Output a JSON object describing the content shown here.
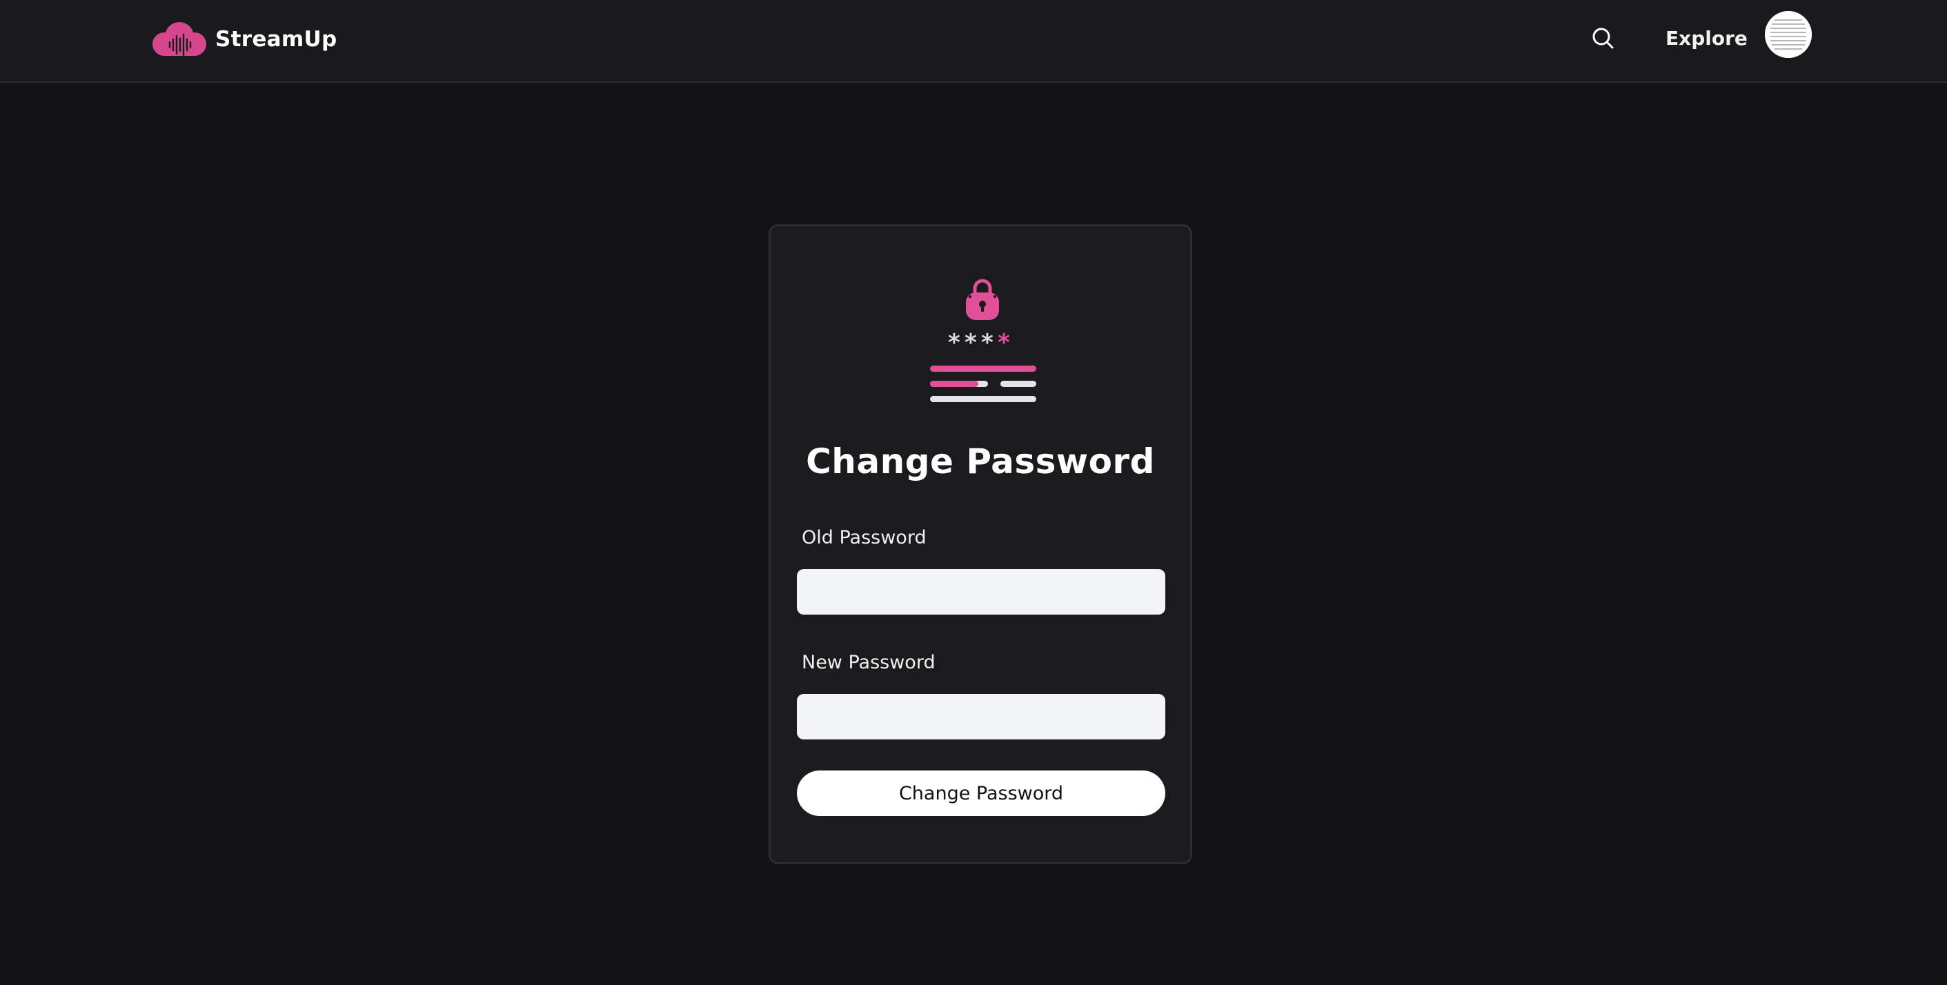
{
  "brand": {
    "name": "StreamUp",
    "logo_icon": "cloud-soundwave-icon",
    "accent_color": "#d6468c"
  },
  "nav": {
    "search_icon": "search-icon",
    "explore_label": "Explore",
    "avatar_icon": "user-avatar"
  },
  "card": {
    "illustration_icon": "lock-password-icon",
    "title": "Change Password",
    "old_password": {
      "label": "Old Password",
      "value": "",
      "placeholder": ""
    },
    "new_password": {
      "label": "New Password",
      "value": "",
      "placeholder": ""
    },
    "submit_label": "Change Password"
  },
  "colors": {
    "background": "#131316",
    "topbar": "#1a1a1d",
    "card": "#1b1b1e",
    "accent": "#d6468c",
    "input_bg": "#f3f4f6"
  }
}
